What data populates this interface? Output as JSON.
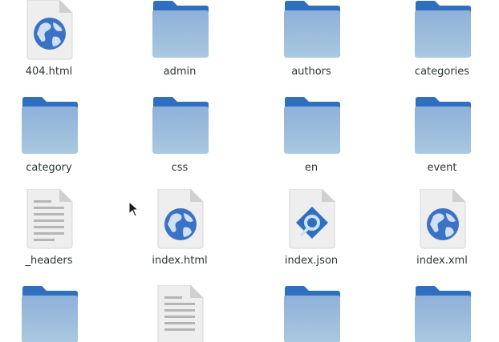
{
  "file_manager": {
    "items": [
      {
        "name": "404.html",
        "type": "html-file"
      },
      {
        "name": "admin",
        "type": "folder"
      },
      {
        "name": "authors",
        "type": "folder"
      },
      {
        "name": "categories",
        "type": "folder"
      },
      {
        "name": "category",
        "type": "folder"
      },
      {
        "name": "css",
        "type": "folder"
      },
      {
        "name": "en",
        "type": "folder"
      },
      {
        "name": "event",
        "type": "folder"
      },
      {
        "name": "_headers",
        "type": "text-file"
      },
      {
        "name": "index.html",
        "type": "html-file"
      },
      {
        "name": "index.json",
        "type": "json-file"
      },
      {
        "name": "index.xml",
        "type": "html-file"
      },
      {
        "name": "",
        "type": "folder"
      },
      {
        "name": "",
        "type": "text-file"
      },
      {
        "name": "",
        "type": "folder"
      },
      {
        "name": "",
        "type": "folder"
      }
    ]
  },
  "colors": {
    "folder_back": "#2f6fc0",
    "folder_front_top": "#8fb0da",
    "folder_front_bottom": "#a9c8e0",
    "doc_page": "#eeeeee",
    "globe_blue": "#3b72c6",
    "label_text": "#2e3436"
  }
}
